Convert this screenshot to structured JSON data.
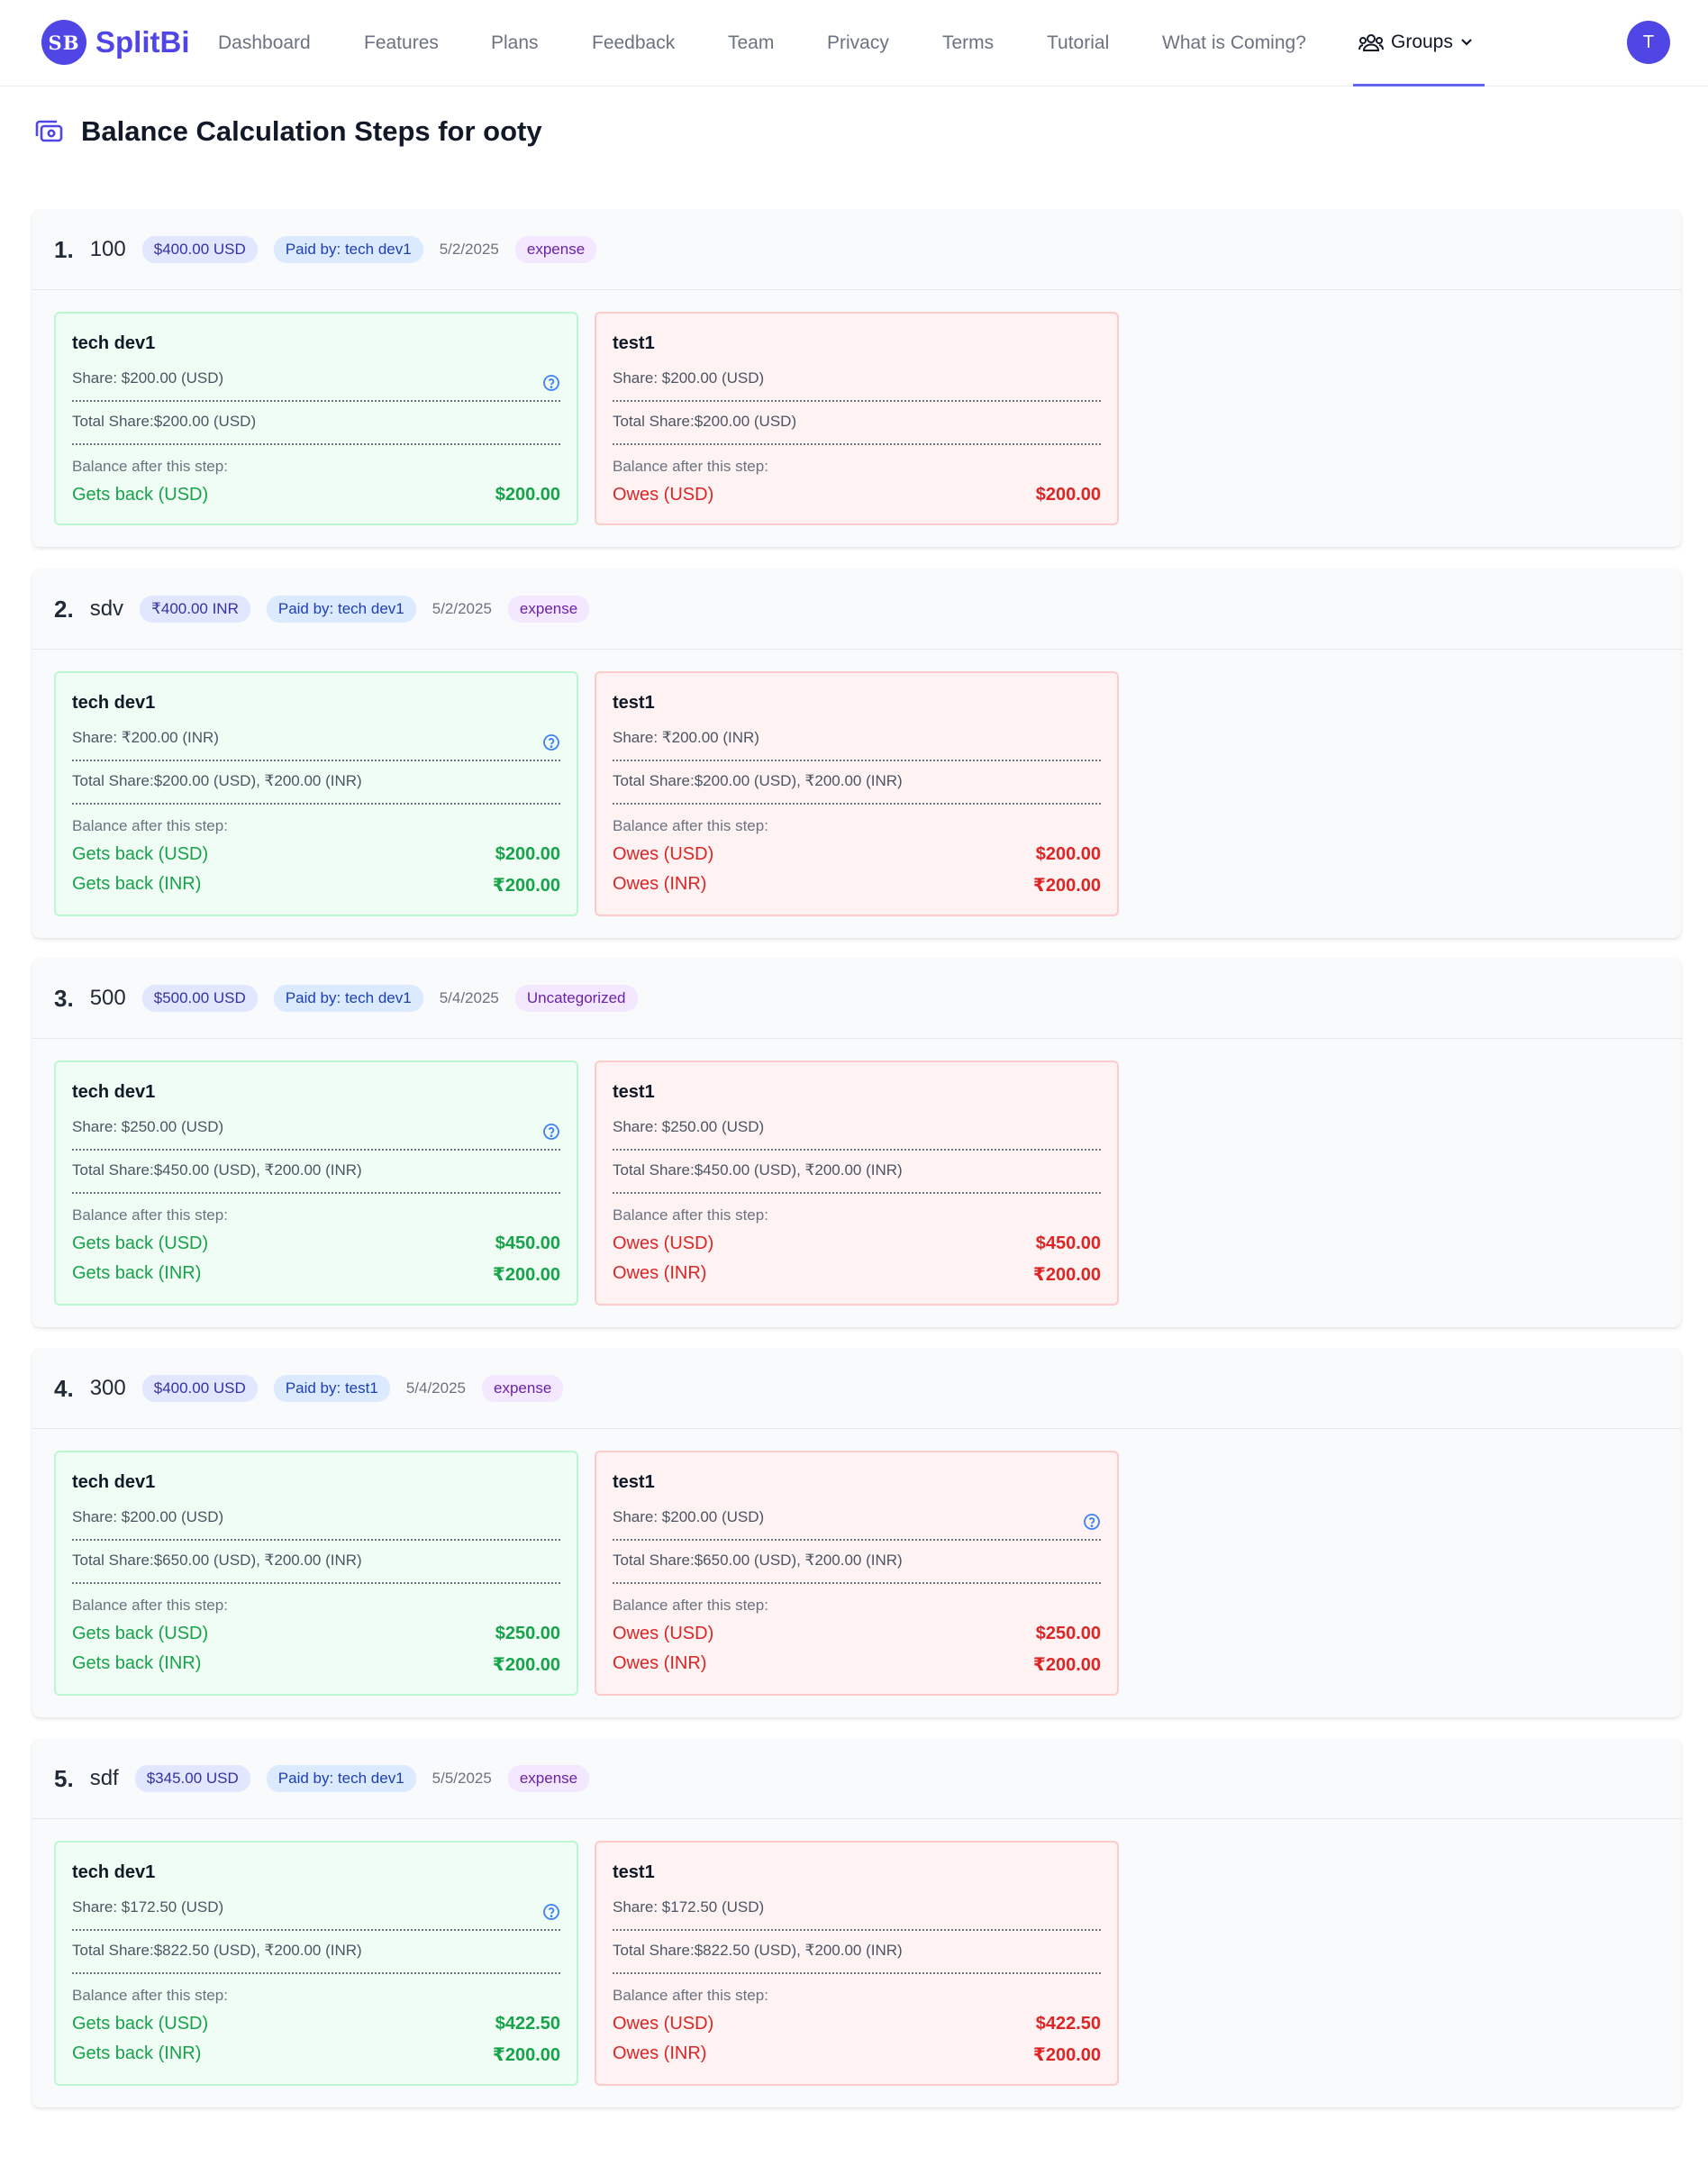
{
  "nav": {
    "logo_mark": "SB",
    "brand": "SplitBi",
    "items": [
      {
        "label": "Dashboard"
      },
      {
        "label": "Features"
      },
      {
        "label": "Plans"
      },
      {
        "label": "Feedback"
      },
      {
        "label": "Team"
      },
      {
        "label": "Privacy"
      },
      {
        "label": "Terms"
      },
      {
        "label": "Tutorial"
      },
      {
        "label": "What is Coming?"
      }
    ],
    "groups_label": "Groups",
    "avatar_initial": "T",
    "accent_color": "#4f46e5"
  },
  "page": {
    "title": "Balance Calculation Steps for ooty",
    "balance_label": "Balance after this step:"
  },
  "steps": [
    {
      "number": "1.",
      "title": "100",
      "amount": "$400.00 USD",
      "paid_by": "Paid by: tech dev1",
      "date": "5/2/2025",
      "category": "expense",
      "members": [
        {
          "name": "tech dev1",
          "share": "Share: $200.00 (USD)",
          "total": "Total Share:$200.00 (USD)",
          "balances": [
            {
              "label": "Gets back (USD)",
              "amount": "$200.00"
            }
          ]
        },
        {
          "name": "test1",
          "share": "Share: $200.00 (USD)",
          "total": "Total Share:$200.00 (USD)",
          "balances": [
            {
              "label": "Owes (USD)",
              "amount": "$200.00"
            }
          ]
        }
      ]
    },
    {
      "number": "2.",
      "title": "sdv",
      "amount": "₹400.00 INR",
      "paid_by": "Paid by: tech dev1",
      "date": "5/2/2025",
      "category": "expense",
      "members": [
        {
          "name": "tech dev1",
          "share": "Share: ₹200.00 (INR)",
          "total": "Total Share:$200.00 (USD), ₹200.00 (INR)",
          "balances": [
            {
              "label": "Gets back (USD)",
              "amount": "$200.00"
            },
            {
              "label": "Gets back (INR)",
              "amount": "₹200.00"
            }
          ]
        },
        {
          "name": "test1",
          "share": "Share: ₹200.00 (INR)",
          "total": "Total Share:$200.00 (USD), ₹200.00 (INR)",
          "balances": [
            {
              "label": "Owes (USD)",
              "amount": "$200.00"
            },
            {
              "label": "Owes (INR)",
              "amount": "₹200.00"
            }
          ]
        }
      ]
    },
    {
      "number": "3.",
      "title": "500",
      "amount": "$500.00 USD",
      "paid_by": "Paid by: tech dev1",
      "date": "5/4/2025",
      "category": "Uncategorized",
      "members": [
        {
          "name": "tech dev1",
          "share": "Share: $250.00 (USD)",
          "total": "Total Share:$450.00 (USD), ₹200.00 (INR)",
          "balances": [
            {
              "label": "Gets back (USD)",
              "amount": "$450.00"
            },
            {
              "label": "Gets back (INR)",
              "amount": "₹200.00"
            }
          ]
        },
        {
          "name": "test1",
          "share": "Share: $250.00 (USD)",
          "total": "Total Share:$450.00 (USD), ₹200.00 (INR)",
          "balances": [
            {
              "label": "Owes (USD)",
              "amount": "$450.00"
            },
            {
              "label": "Owes (INR)",
              "amount": "₹200.00"
            }
          ]
        }
      ]
    },
    {
      "number": "4.",
      "title": "300",
      "amount": "$400.00 USD",
      "paid_by": "Paid by: test1",
      "date": "5/4/2025",
      "category": "expense",
      "members": [
        {
          "name": "tech dev1",
          "share": "Share: $200.00 (USD)",
          "total": "Total Share:$650.00 (USD), ₹200.00 (INR)",
          "balances": [
            {
              "label": "Gets back (USD)",
              "amount": "$250.00"
            },
            {
              "label": "Gets back (INR)",
              "amount": "₹200.00"
            }
          ]
        },
        {
          "name": "test1",
          "share": "Share: $200.00 (USD)",
          "total": "Total Share:$650.00 (USD), ₹200.00 (INR)",
          "balances": [
            {
              "label": "Owes (USD)",
              "amount": "$250.00"
            },
            {
              "label": "Owes (INR)",
              "amount": "₹200.00"
            }
          ]
        }
      ]
    },
    {
      "number": "5.",
      "title": "sdf",
      "amount": "$345.00 USD",
      "paid_by": "Paid by: tech dev1",
      "date": "5/5/2025",
      "category": "expense",
      "members": [
        {
          "name": "tech dev1",
          "share": "Share: $172.50 (USD)",
          "total": "Total Share:$822.50 (USD), ₹200.00 (INR)",
          "balances": [
            {
              "label": "Gets back (USD)",
              "amount": "$422.50"
            },
            {
              "label": "Gets back (INR)",
              "amount": "₹200.00"
            }
          ]
        },
        {
          "name": "test1",
          "share": "Share: $172.50 (USD)",
          "total": "Total Share:$822.50 (USD), ₹200.00 (INR)",
          "balances": [
            {
              "label": "Owes (USD)",
              "amount": "$422.50"
            },
            {
              "label": "Owes (INR)",
              "amount": "₹200.00"
            }
          ]
        }
      ]
    }
  ]
}
